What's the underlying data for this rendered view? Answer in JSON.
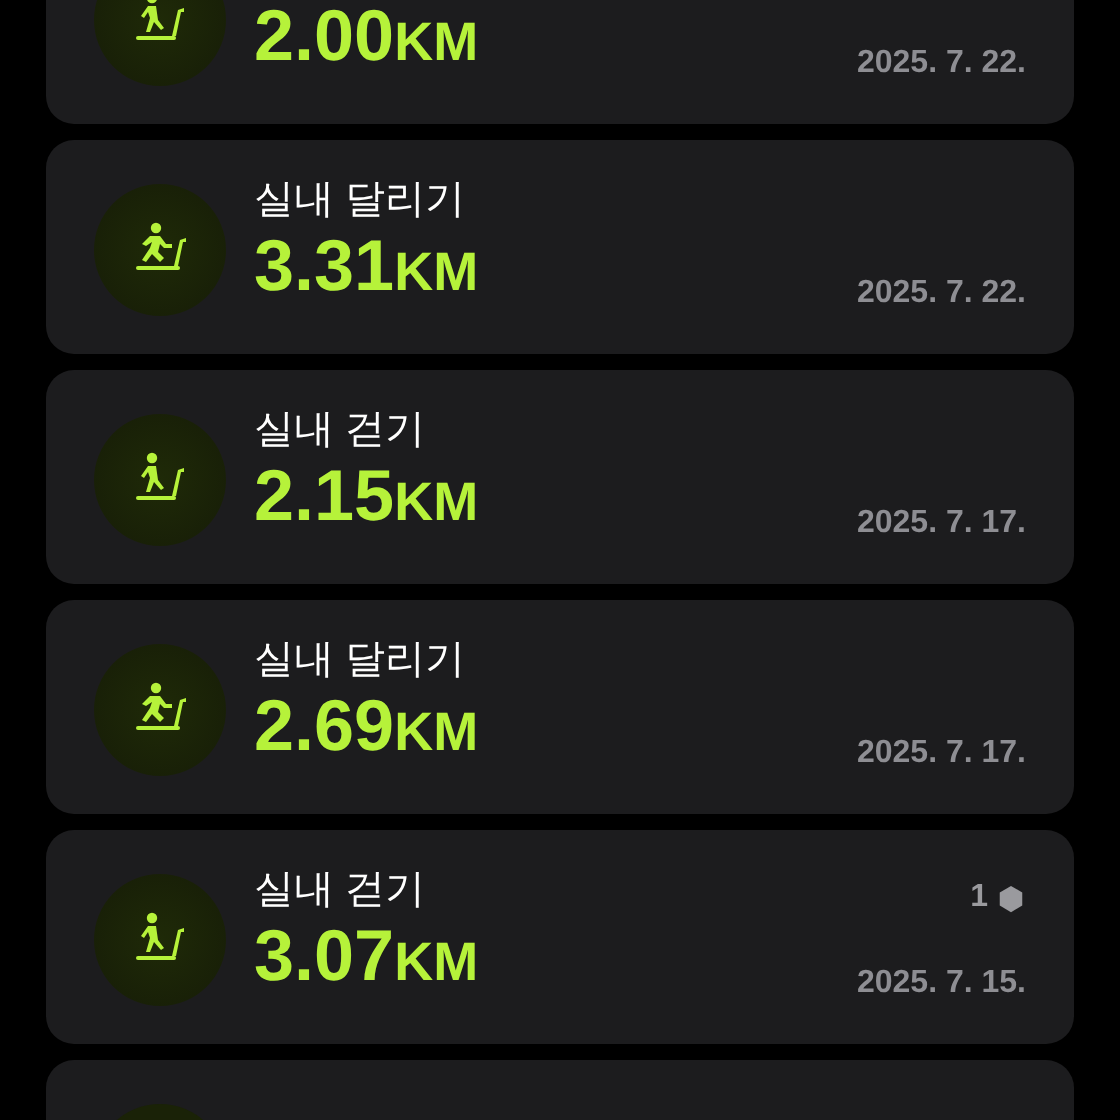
{
  "workouts": [
    {
      "kind": "walk",
      "distance": "2.00",
      "unit": "KM",
      "date": "2025. 7. 22."
    },
    {
      "kind": "run",
      "title": "실내 달리기",
      "distance": "3.31",
      "unit": "KM",
      "date": "2025. 7. 22."
    },
    {
      "kind": "walk",
      "title": "실내 걷기",
      "distance": "2.15",
      "unit": "KM",
      "date": "2025. 7. 17."
    },
    {
      "kind": "run",
      "title": "실내 달리기",
      "distance": "2.69",
      "unit": "KM",
      "date": "2025. 7. 17."
    },
    {
      "kind": "walk",
      "title": "실내 걷기",
      "distance": "3.07",
      "unit": "KM",
      "date": "2025. 7. 15.",
      "badge": "1"
    }
  ]
}
